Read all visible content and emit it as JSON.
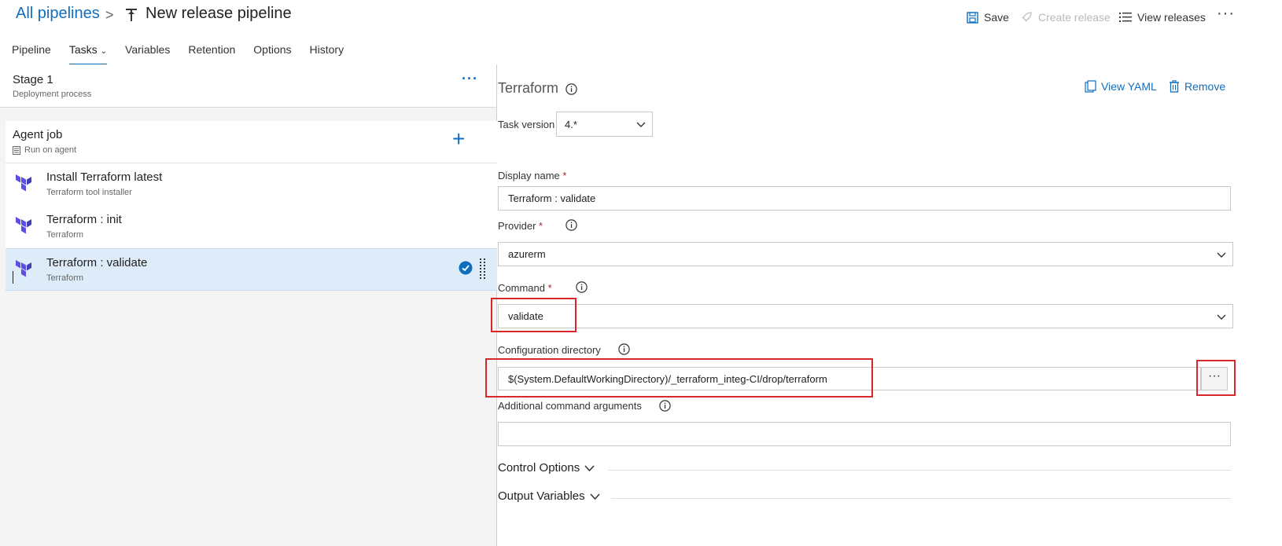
{
  "header": {
    "breadcrumb_link": "All pipelines",
    "breadcrumb_sep": ">",
    "title": "New release pipeline",
    "actions": {
      "save": "Save",
      "create_release": "Create release",
      "view_releases": "View releases",
      "more": "···"
    }
  },
  "tabs": {
    "items": [
      "Pipeline",
      "Tasks",
      "Variables",
      "Retention",
      "Options",
      "History"
    ],
    "active": "Tasks"
  },
  "left": {
    "stage": {
      "title": "Stage 1",
      "subtitle": "Deployment process",
      "more": "···"
    },
    "job": {
      "title": "Agent job",
      "subtitle": "Run on agent",
      "add": "+"
    },
    "tasks": [
      {
        "title": "Install Terraform latest",
        "subtitle": "Terraform tool installer"
      },
      {
        "title": "Terraform : init",
        "subtitle": "Terraform"
      },
      {
        "title": "Terraform : validate",
        "subtitle": "Terraform"
      }
    ],
    "selected_task_index": 2
  },
  "right": {
    "heading": "Terraform",
    "view_yaml": "View YAML",
    "remove": "Remove",
    "task_version_label": "Task version",
    "task_version_value": "4.*",
    "display_name_label": "Display name",
    "display_name_value": "Terraform : validate",
    "provider_label": "Provider",
    "provider_value": "azurerm",
    "command_label": "Command",
    "command_value": "validate",
    "config_dir_label": "Configuration directory",
    "config_dir_value": "$(System.DefaultWorkingDirectory)/_terraform_integ-CI/drop/terraform",
    "config_dir_browse": "···",
    "additional_args_label": "Additional command arguments",
    "additional_args_value": "",
    "required_mark": "*",
    "control_options": "Control Options",
    "output_variables": "Output Variables"
  },
  "colors": {
    "accent": "#106ebe",
    "selected_row": "#deecf9",
    "highlight_box": "#d9262b",
    "terraform_purple": "#5c4ee5"
  }
}
